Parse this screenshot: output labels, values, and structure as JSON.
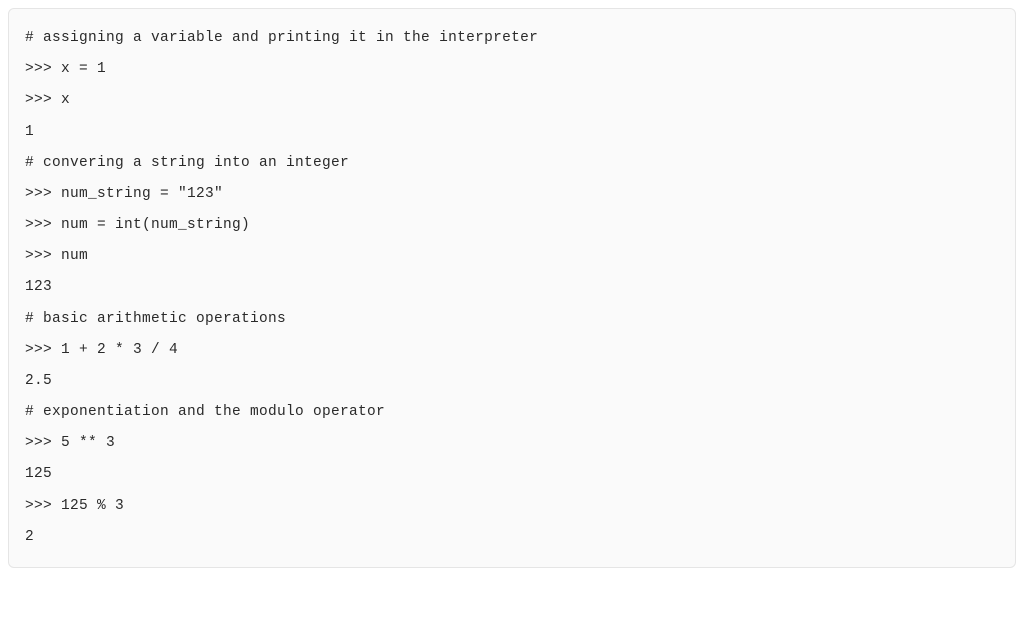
{
  "code": {
    "lines": [
      "# assigning a variable and printing it in the interpreter",
      ">>> x = 1",
      ">>> x",
      "1",
      "# convering a string into an integer",
      ">>> num_string = \"123\"",
      ">>> num = int(num_string)",
      ">>> num",
      "123",
      "# basic arithmetic operations",
      ">>> 1 + 2 * 3 / 4",
      "2.5",
      "# exponentiation and the modulo operator",
      ">>> 5 ** 3",
      "125",
      ">>> 125 % 3",
      "2"
    ]
  }
}
